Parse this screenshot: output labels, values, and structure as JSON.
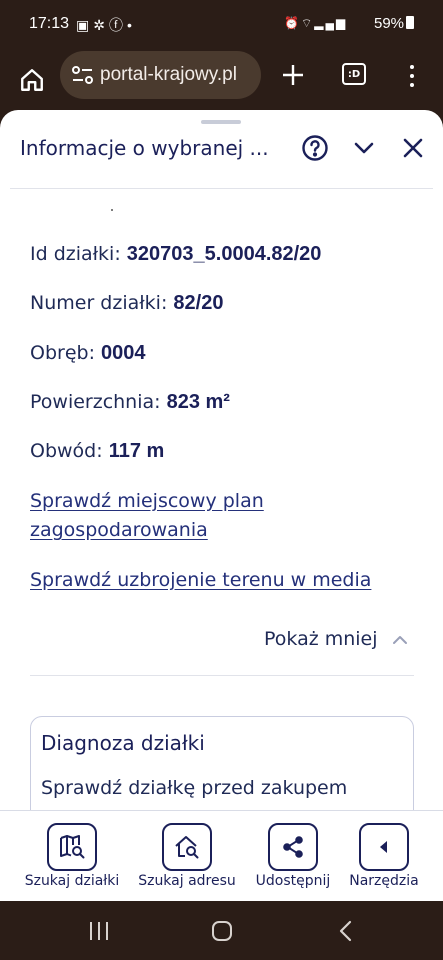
{
  "status_bar": {
    "time": "17:13",
    "left_icons": [
      "gallery-icon",
      "fan-icon",
      "facebook-icon",
      "dot-icon"
    ],
    "right_icons": [
      "alarm-icon",
      "clock-icon",
      "wifi-icon",
      "signal-icon",
      "signal-icon"
    ],
    "battery": "59%"
  },
  "browser": {
    "url": "portal-krajowy.pl",
    "tabs_label": ":D"
  },
  "sheet": {
    "title": "Informacje o wybranej ...",
    "rows": [
      {
        "label": "Id działki: ",
        "value": "320703_5.0004.82/20"
      },
      {
        "label": "Numer działki: ",
        "value": "82/20"
      },
      {
        "label": "Obręb: ",
        "value": "0004"
      },
      {
        "label": "Powierzchnia: ",
        "value": "823 m²"
      },
      {
        "label": "Obwód: ",
        "value": "117 m"
      }
    ],
    "links": {
      "plan_line1": "Sprawdź miejscowy plan",
      "plan_line2": "zagospodarowania",
      "media": "Sprawdź uzbrojenie terenu w media"
    },
    "show_less": "Pokaż mniej",
    "diagnosis": {
      "title": "Diagnoza działki",
      "subtitle": "Sprawdź działkę przed zakupem"
    }
  },
  "toolbar": {
    "items": [
      {
        "label": "Szukaj działki"
      },
      {
        "label": "Szukaj adresu"
      },
      {
        "label": "Udostępnij"
      },
      {
        "label": "Narzędzia"
      }
    ]
  },
  "colors": {
    "primary": "#1b2059",
    "link": "#24307a",
    "system_bar": "#2b1d17",
    "url_pill": "#4a3a2e"
  }
}
